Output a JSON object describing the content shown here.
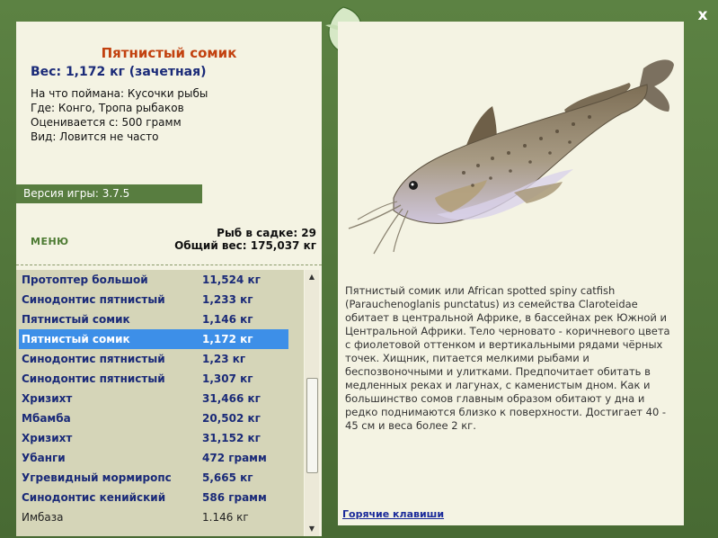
{
  "window": {
    "close_label": "x"
  },
  "fish": {
    "title": "Пятнистый сомик",
    "weight_line": "Вес: 1,172 кг (зачетная)",
    "caught_on": "На что поймана: Кусочки рыбы",
    "location": "Где: Конго, Тропа рыбаков",
    "valued_from": "Оценивается с: 500 грамм",
    "rarity": "Вид: Ловится не часто"
  },
  "version": "Версия игры: 3.7.5",
  "menu_label": "МЕНЮ",
  "keep": {
    "count": "Рыб в садке: 29",
    "total_weight": "Общий вес: 175,037 кг"
  },
  "fish_list": [
    {
      "name": "Протоптер большой",
      "weight": "11,524 кг"
    },
    {
      "name": "Синодонтис пятнистый",
      "weight": "1,233 кг"
    },
    {
      "name": "Пятнистый сомик",
      "weight": "1,146 кг"
    },
    {
      "name": "Пятнистый сомик",
      "weight": "1,172 кг"
    },
    {
      "name": "Синодонтис пятнистый",
      "weight": "1,23 кг"
    },
    {
      "name": "Синодонтис пятнистый",
      "weight": "1,307 кг"
    },
    {
      "name": "Хризихт",
      "weight": "31,466 кг"
    },
    {
      "name": "Мбамба",
      "weight": "20,502 кг"
    },
    {
      "name": "Хризихт",
      "weight": "31,152 кг"
    },
    {
      "name": "Убанги",
      "weight": "472 грамм"
    },
    {
      "name": "Угревидный мормиропс",
      "weight": "5,665 кг"
    },
    {
      "name": "Синодонтис кенийский",
      "weight": "586 грамм"
    },
    {
      "name": "Имбаза",
      "weight": "1.146 кг"
    }
  ],
  "description": "Пятнистый сомик или African spotted spiny catfish (Parauchenoglanis punctatus) из семейства Claroteidae обитает в центральной Африке, в бассейнах рек Южной и Центральной Африки. Тело черновато - коричневого цвета с фиолетовой оттенком и вертикальными рядами чёрных точек. Хищник, питается мелкими рыбами и беспозвоночными и улитками. Предпочитает обитать в медленных реках и лагунах, с каменистым дном. Как и большинство сомов главным образом обитают у дна и редко поднимаются близко к поверхности. Достигает 40 - 45 см и веса более 2 кг.",
  "hotkeys_label": "Горячие клавиши"
}
